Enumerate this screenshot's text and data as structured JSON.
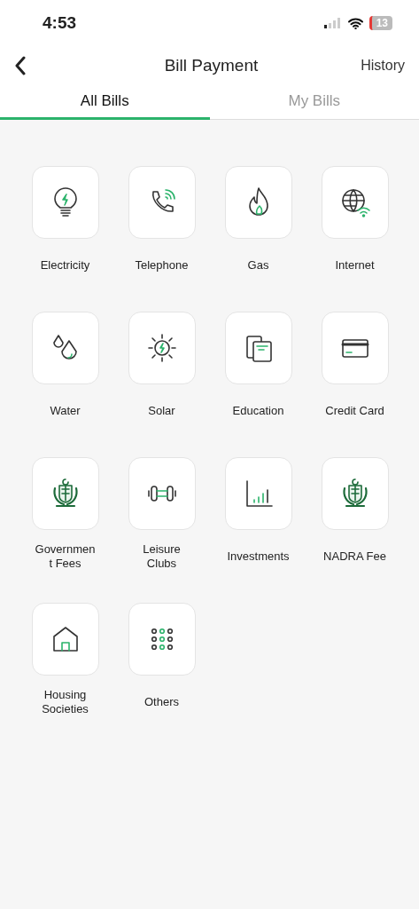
{
  "status_bar": {
    "time": "4:53",
    "battery": "13"
  },
  "header": {
    "title": "Bill Payment",
    "action": "History"
  },
  "tabs": [
    {
      "label": "All Bills",
      "selected": true
    },
    {
      "label": "My Bills",
      "selected": false
    }
  ],
  "categories": [
    {
      "label": "Electricity",
      "kind": "bulb"
    },
    {
      "label": "Telephone",
      "kind": "phone"
    },
    {
      "label": "Gas",
      "kind": "flame"
    },
    {
      "label": "Internet",
      "kind": "globe"
    },
    {
      "label": "Water",
      "kind": "drops"
    },
    {
      "label": "Solar",
      "kind": "sun"
    },
    {
      "label": "Education",
      "kind": "books"
    },
    {
      "label": "Credit Card",
      "kind": "card"
    },
    {
      "label": "Governmen\nt Fees",
      "kind": "emblem"
    },
    {
      "label": "Leisure\nClubs",
      "kind": "dumbbell"
    },
    {
      "label": "Investments",
      "kind": "chart"
    },
    {
      "label": "NADRA Fee",
      "kind": "emblem"
    },
    {
      "label": "Housing\nSocieties",
      "kind": "house"
    },
    {
      "label": "Others",
      "kind": "dots"
    }
  ]
}
